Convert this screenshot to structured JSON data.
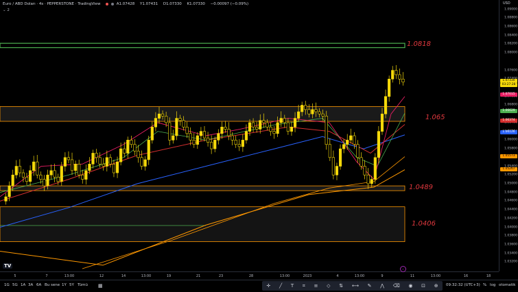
{
  "header": {
    "symbol_title": "Euro / ABD Doları · 4s · PEPPERSTONE · TradingView",
    "open": "A1.07428",
    "high": "Y1.07431",
    "low": "D1.07330",
    "close": "K1.07330",
    "change": "−0.00097 (−0.09%)",
    "collapse_label": "⌄ 2"
  },
  "price_scale": {
    "currency": "USD",
    "labels": [
      "1.09000",
      "1.08800",
      "1.08600",
      "1.08400",
      "1.08200",
      "1.08000",
      "1.07600",
      "1.07400",
      "1.07000",
      "1.06800",
      "1.06400",
      "1.06200",
      "1.06000",
      "1.05800",
      "1.05400",
      "1.05200",
      "1.05000",
      "1.04800",
      "1.04600",
      "1.04400",
      "1.04200",
      "1.04000",
      "1.03800",
      "1.03600",
      "1.03400",
      "1.03200"
    ],
    "badges": [
      {
        "text": "1.07330",
        "color": "#f5d90a",
        "text_color": "#000"
      },
      {
        "text": "03:27:28",
        "color": "#f5d90a",
        "text_color": "#000"
      },
      {
        "text": "1.07015",
        "color": "#e91e63",
        "text_color": "#fff"
      },
      {
        "text": "1.06629",
        "color": "#4caf50",
        "text_color": "#fff"
      },
      {
        "text": "1.06374",
        "color": "#d32f2f",
        "text_color": "#fff"
      },
      {
        "text": "1.06126",
        "color": "#2962ff",
        "text_color": "#fff"
      },
      {
        "text": "1.05573",
        "color": "#ff9800",
        "text_color": "#000"
      },
      {
        "text": "1.05267",
        "color": "#ff9800",
        "text_color": "#000"
      }
    ]
  },
  "levels": [
    {
      "label": "1.0818",
      "price": 1.0818
    },
    {
      "label": "1.065",
      "price": 1.065
    },
    {
      "label": "1.0489",
      "price": 1.0489
    },
    {
      "label": "1.0406",
      "price": 1.0406
    }
  ],
  "time_axis": {
    "labels": [
      "5",
      "7",
      "13:00",
      "12",
      "14",
      "13:00",
      "19",
      "21",
      "23",
      "28",
      "13:00",
      "2023",
      "4",
      "13:00",
      "9",
      "11",
      "13:00",
      "16",
      "18"
    ]
  },
  "bottom_bar": {
    "timeframes": [
      "1G",
      "5G",
      "1A",
      "3A",
      "6A",
      "Bu sene",
      "1Y",
      "5Y",
      "Tümü"
    ],
    "compare_icon": "calendar-range-icon",
    "tools": [
      "cursor-cross-icon",
      "trend-line-icon",
      "text-icon",
      "pattern-icon",
      "fib-icon",
      "shape-icon",
      "long-position-icon",
      "measure-icon",
      "brush-icon",
      "zigzag-icon",
      "eraser-icon",
      "hide-icon",
      "lock-icon",
      "zoom-icon"
    ],
    "clock": "09:32:32 (UTC+3)",
    "percent": "%",
    "log": "log",
    "auto": "otomatik"
  },
  "colors": {
    "candle": "#f5d90a",
    "ema_fast": "#e91e63",
    "ema_green": "#4caf50",
    "ema_red": "#d32f2f",
    "ema_blue": "#2962ff",
    "ema_orange": "#ff9800",
    "resistance_zone": "#4caf50",
    "zone_border": "#ff9800",
    "level_label": "#e0383e"
  }
}
